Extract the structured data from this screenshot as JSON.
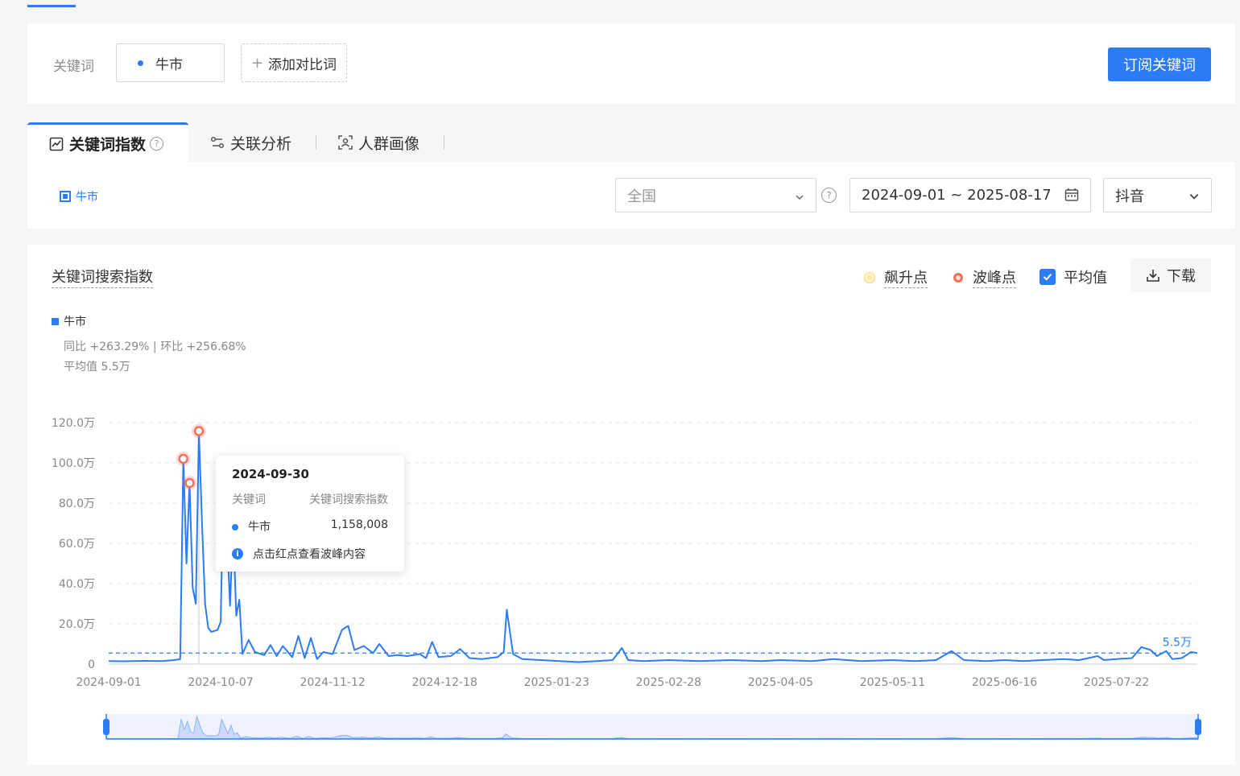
{
  "keyword_bar": {
    "label": "关键词",
    "keyword": "牛市",
    "add_label": "添加对比词",
    "subscribe_label": "订阅关键词"
  },
  "tabs": [
    {
      "label": "关键词指数",
      "active": true
    },
    {
      "label": "关联分析",
      "active": false
    },
    {
      "label": "人群画像",
      "active": false
    }
  ],
  "filters": {
    "legend_keyword": "牛市",
    "region": "全国",
    "date_range": "2024-09-01 ~ 2025-08-17",
    "platform": "抖音"
  },
  "chart_panel": {
    "title": "关键词搜索指数",
    "legend_rise": "飙升点",
    "legend_peak": "波峰点",
    "avg_label": "平均值",
    "download_label": "下载",
    "series_name": "牛市",
    "yoy_mom": "同比 +263.29% | 环比 +256.68%",
    "avg_text": "平均值 5.5万",
    "avg_line_label": "5.5万"
  },
  "tooltip": {
    "date": "2024-09-30",
    "col_keyword": "关键词",
    "col_index": "关键词搜索指数",
    "keyword": "牛市",
    "value": "1,158,008",
    "hint": "点击红点查看波峰内容"
  },
  "colors": {
    "accent": "#2b7cf6",
    "peak": "#f2705b",
    "rise": "#ffc53d"
  },
  "chart_data": {
    "type": "line",
    "x_start": "2024-09-01",
    "x_end": "2025-08-17",
    "x_ticks": [
      "2024-09-01",
      "2024-10-07",
      "2024-11-12",
      "2024-12-18",
      "2025-01-23",
      "2025-02-28",
      "2025-04-05",
      "2025-05-11",
      "2025-06-16",
      "2025-07-22"
    ],
    "y_ticks": [
      "0",
      "20.0万",
      "40.0万",
      "60.0万",
      "80.0万",
      "100.0万",
      "120.0万"
    ],
    "ylim": [
      0,
      1200000
    ],
    "average": 55000,
    "series": [
      {
        "name": "牛市",
        "points": [
          [
            "2024-09-01",
            15000
          ],
          [
            "2024-09-06",
            14000
          ],
          [
            "2024-09-12",
            16000
          ],
          [
            "2024-09-18",
            15000
          ],
          [
            "2024-09-22",
            20000
          ],
          [
            "2024-09-24",
            25000
          ],
          [
            "2024-09-25",
            1020000
          ],
          [
            "2024-09-26",
            500000
          ],
          [
            "2024-09-27",
            900000
          ],
          [
            "2024-09-28",
            380000
          ],
          [
            "2024-09-29",
            300000
          ],
          [
            "2024-09-30",
            1158008
          ],
          [
            "2024-10-01",
            700000
          ],
          [
            "2024-10-02",
            300000
          ],
          [
            "2024-10-03",
            180000
          ],
          [
            "2024-10-04",
            160000
          ],
          [
            "2024-10-06",
            170000
          ],
          [
            "2024-10-07",
            210000
          ],
          [
            "2024-10-08",
            1000000
          ],
          [
            "2024-10-09",
            650000
          ],
          [
            "2024-10-10",
            290000
          ],
          [
            "2024-10-11",
            700000
          ],
          [
            "2024-10-12",
            240000
          ],
          [
            "2024-10-13",
            320000
          ],
          [
            "2024-10-14",
            50000
          ],
          [
            "2024-10-16",
            120000
          ],
          [
            "2024-10-18",
            60000
          ],
          [
            "2024-10-21",
            45000
          ],
          [
            "2024-10-23",
            95000
          ],
          [
            "2024-10-25",
            40000
          ],
          [
            "2024-10-27",
            90000
          ],
          [
            "2024-10-30",
            35000
          ],
          [
            "2024-11-01",
            140000
          ],
          [
            "2024-11-03",
            30000
          ],
          [
            "2024-11-05",
            130000
          ],
          [
            "2024-11-07",
            25000
          ],
          [
            "2024-11-09",
            60000
          ],
          [
            "2024-11-12",
            50000
          ],
          [
            "2024-11-15",
            170000
          ],
          [
            "2024-11-17",
            190000
          ],
          [
            "2024-11-19",
            70000
          ],
          [
            "2024-11-22",
            90000
          ],
          [
            "2024-11-25",
            55000
          ],
          [
            "2024-11-27",
            100000
          ],
          [
            "2024-11-30",
            40000
          ],
          [
            "2024-12-03",
            45000
          ],
          [
            "2024-12-06",
            40000
          ],
          [
            "2024-12-10",
            50000
          ],
          [
            "2024-12-12",
            30000
          ],
          [
            "2024-12-14",
            110000
          ],
          [
            "2024-12-16",
            35000
          ],
          [
            "2024-12-20",
            40000
          ],
          [
            "2024-12-23",
            75000
          ],
          [
            "2024-12-26",
            30000
          ],
          [
            "2024-12-30",
            25000
          ],
          [
            "2025-01-04",
            35000
          ],
          [
            "2025-01-06",
            60000
          ],
          [
            "2025-01-07",
            270000
          ],
          [
            "2025-01-09",
            50000
          ],
          [
            "2025-01-12",
            25000
          ],
          [
            "2025-01-18",
            20000
          ],
          [
            "2025-01-24",
            15000
          ],
          [
            "2025-01-30",
            10000
          ],
          [
            "2025-02-05",
            15000
          ],
          [
            "2025-02-10",
            20000
          ],
          [
            "2025-02-13",
            80000
          ],
          [
            "2025-02-15",
            20000
          ],
          [
            "2025-02-20",
            15000
          ],
          [
            "2025-02-28",
            20000
          ],
          [
            "2025-03-10",
            15000
          ],
          [
            "2025-03-20",
            20000
          ],
          [
            "2025-03-30",
            15000
          ],
          [
            "2025-04-05",
            20000
          ],
          [
            "2025-04-15",
            15000
          ],
          [
            "2025-04-22",
            25000
          ],
          [
            "2025-05-01",
            15000
          ],
          [
            "2025-05-11",
            20000
          ],
          [
            "2025-05-18",
            15000
          ],
          [
            "2025-05-25",
            20000
          ],
          [
            "2025-05-30",
            65000
          ],
          [
            "2025-06-03",
            20000
          ],
          [
            "2025-06-10",
            15000
          ],
          [
            "2025-06-16",
            20000
          ],
          [
            "2025-06-22",
            15000
          ],
          [
            "2025-06-28",
            20000
          ],
          [
            "2025-07-05",
            25000
          ],
          [
            "2025-07-10",
            20000
          ],
          [
            "2025-07-16",
            40000
          ],
          [
            "2025-07-18",
            20000
          ],
          [
            "2025-07-22",
            25000
          ],
          [
            "2025-07-27",
            30000
          ],
          [
            "2025-07-30",
            85000
          ],
          [
            "2025-08-02",
            70000
          ],
          [
            "2025-08-04",
            40000
          ],
          [
            "2025-08-07",
            65000
          ],
          [
            "2025-08-09",
            25000
          ],
          [
            "2025-08-12",
            30000
          ],
          [
            "2025-08-15",
            60000
          ],
          [
            "2025-08-17",
            55000
          ]
        ]
      }
    ],
    "peak_points": [
      "2024-09-25",
      "2024-09-27",
      "2024-09-30",
      "2024-10-08"
    ]
  }
}
